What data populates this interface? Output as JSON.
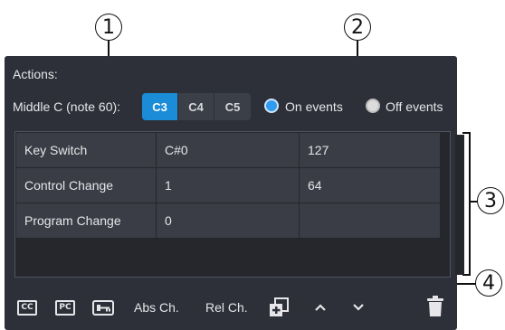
{
  "callouts": [
    "1",
    "2",
    "3",
    "4"
  ],
  "panel": {
    "actions_label": "Actions:",
    "middle_c_label": "Middle C (note 60):",
    "octave_buttons": [
      "C3",
      "C4",
      "C5"
    ],
    "octave_selected": "C3",
    "radio": {
      "on_label": "On events",
      "off_label": "Off events",
      "selected": "On events"
    }
  },
  "table": {
    "rows": [
      [
        "Key Switch",
        "C#0",
        "127"
      ],
      [
        "Control Change",
        "1",
        "64"
      ],
      [
        "Program Change",
        "0",
        ""
      ]
    ]
  },
  "toolbar": {
    "cc_label": "CC",
    "pc_label": "PC",
    "abs_ch": "Abs Ch.",
    "rel_ch": "Rel Ch."
  },
  "colors": {
    "panel_bg": "#2d3038",
    "accent": "#1a8cd8",
    "cell_bg": "#3a3d45"
  }
}
